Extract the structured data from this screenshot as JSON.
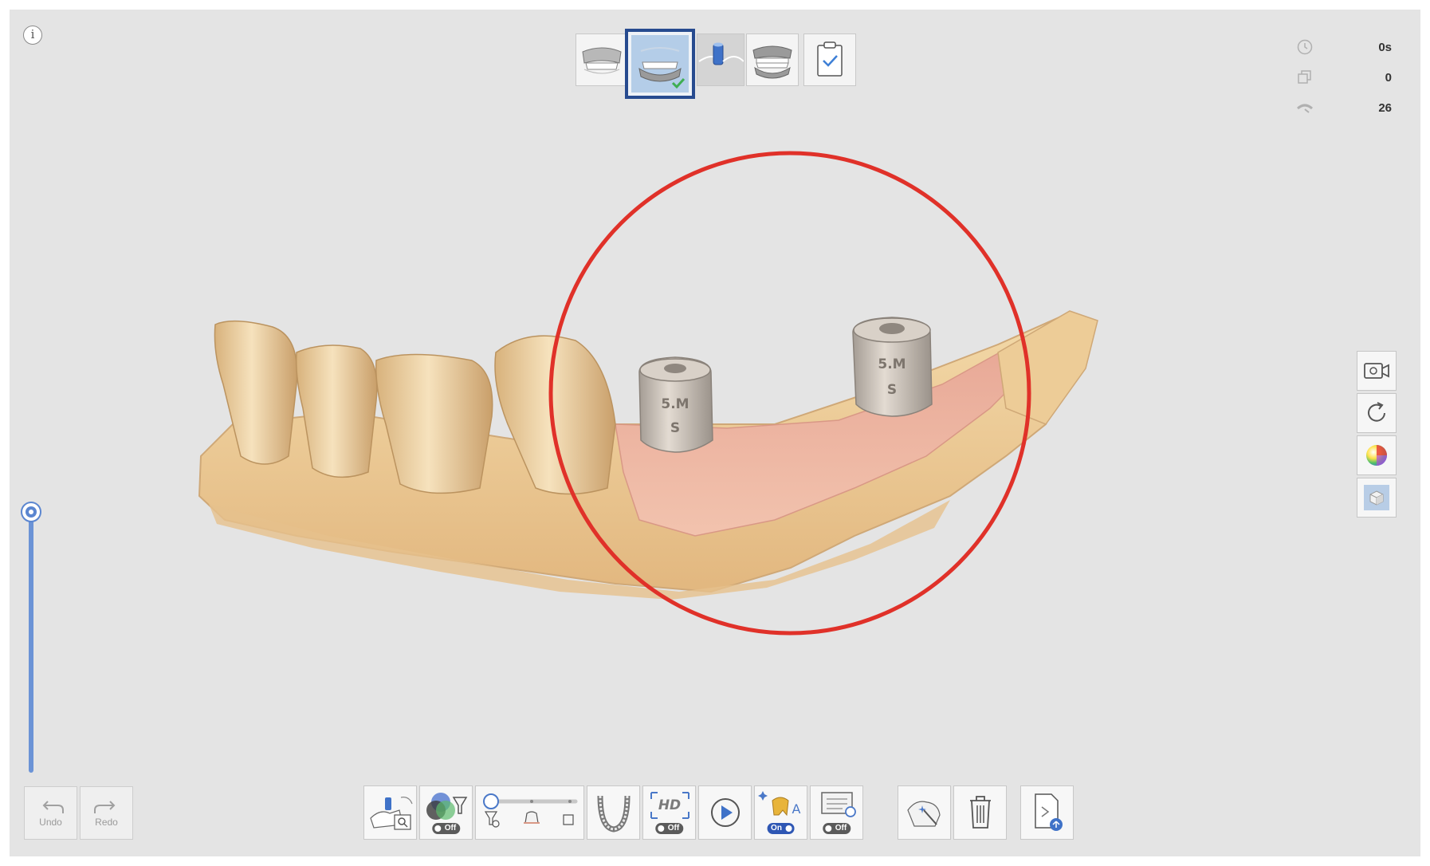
{
  "info": {
    "label": "i"
  },
  "stages": [
    {
      "name": "upper-jaw"
    },
    {
      "name": "lower-jaw",
      "selected": true,
      "completed": true
    },
    {
      "name": "scan-body"
    },
    {
      "name": "occlusion"
    },
    {
      "name": "clipboard-check"
    }
  ],
  "stats": {
    "time": "0s",
    "shots": "0",
    "speed": "26"
  },
  "history": {
    "undo_label": "Undo",
    "redo_label": "Redo"
  },
  "toolbar": {
    "color_filter_toggle": "Off",
    "hd_label": "HD",
    "hd_toggle": "Off",
    "ai_toggle": "On",
    "screen_toggle": "Off"
  },
  "colors": {
    "accent": "#274b8f",
    "slider": "#6b93d6",
    "highlight_circle": "#e03129",
    "toggle_on": "#2f57b4",
    "toggle_off": "#5b5b5b"
  },
  "scanbody_labels": [
    "5.M",
    "S"
  ]
}
